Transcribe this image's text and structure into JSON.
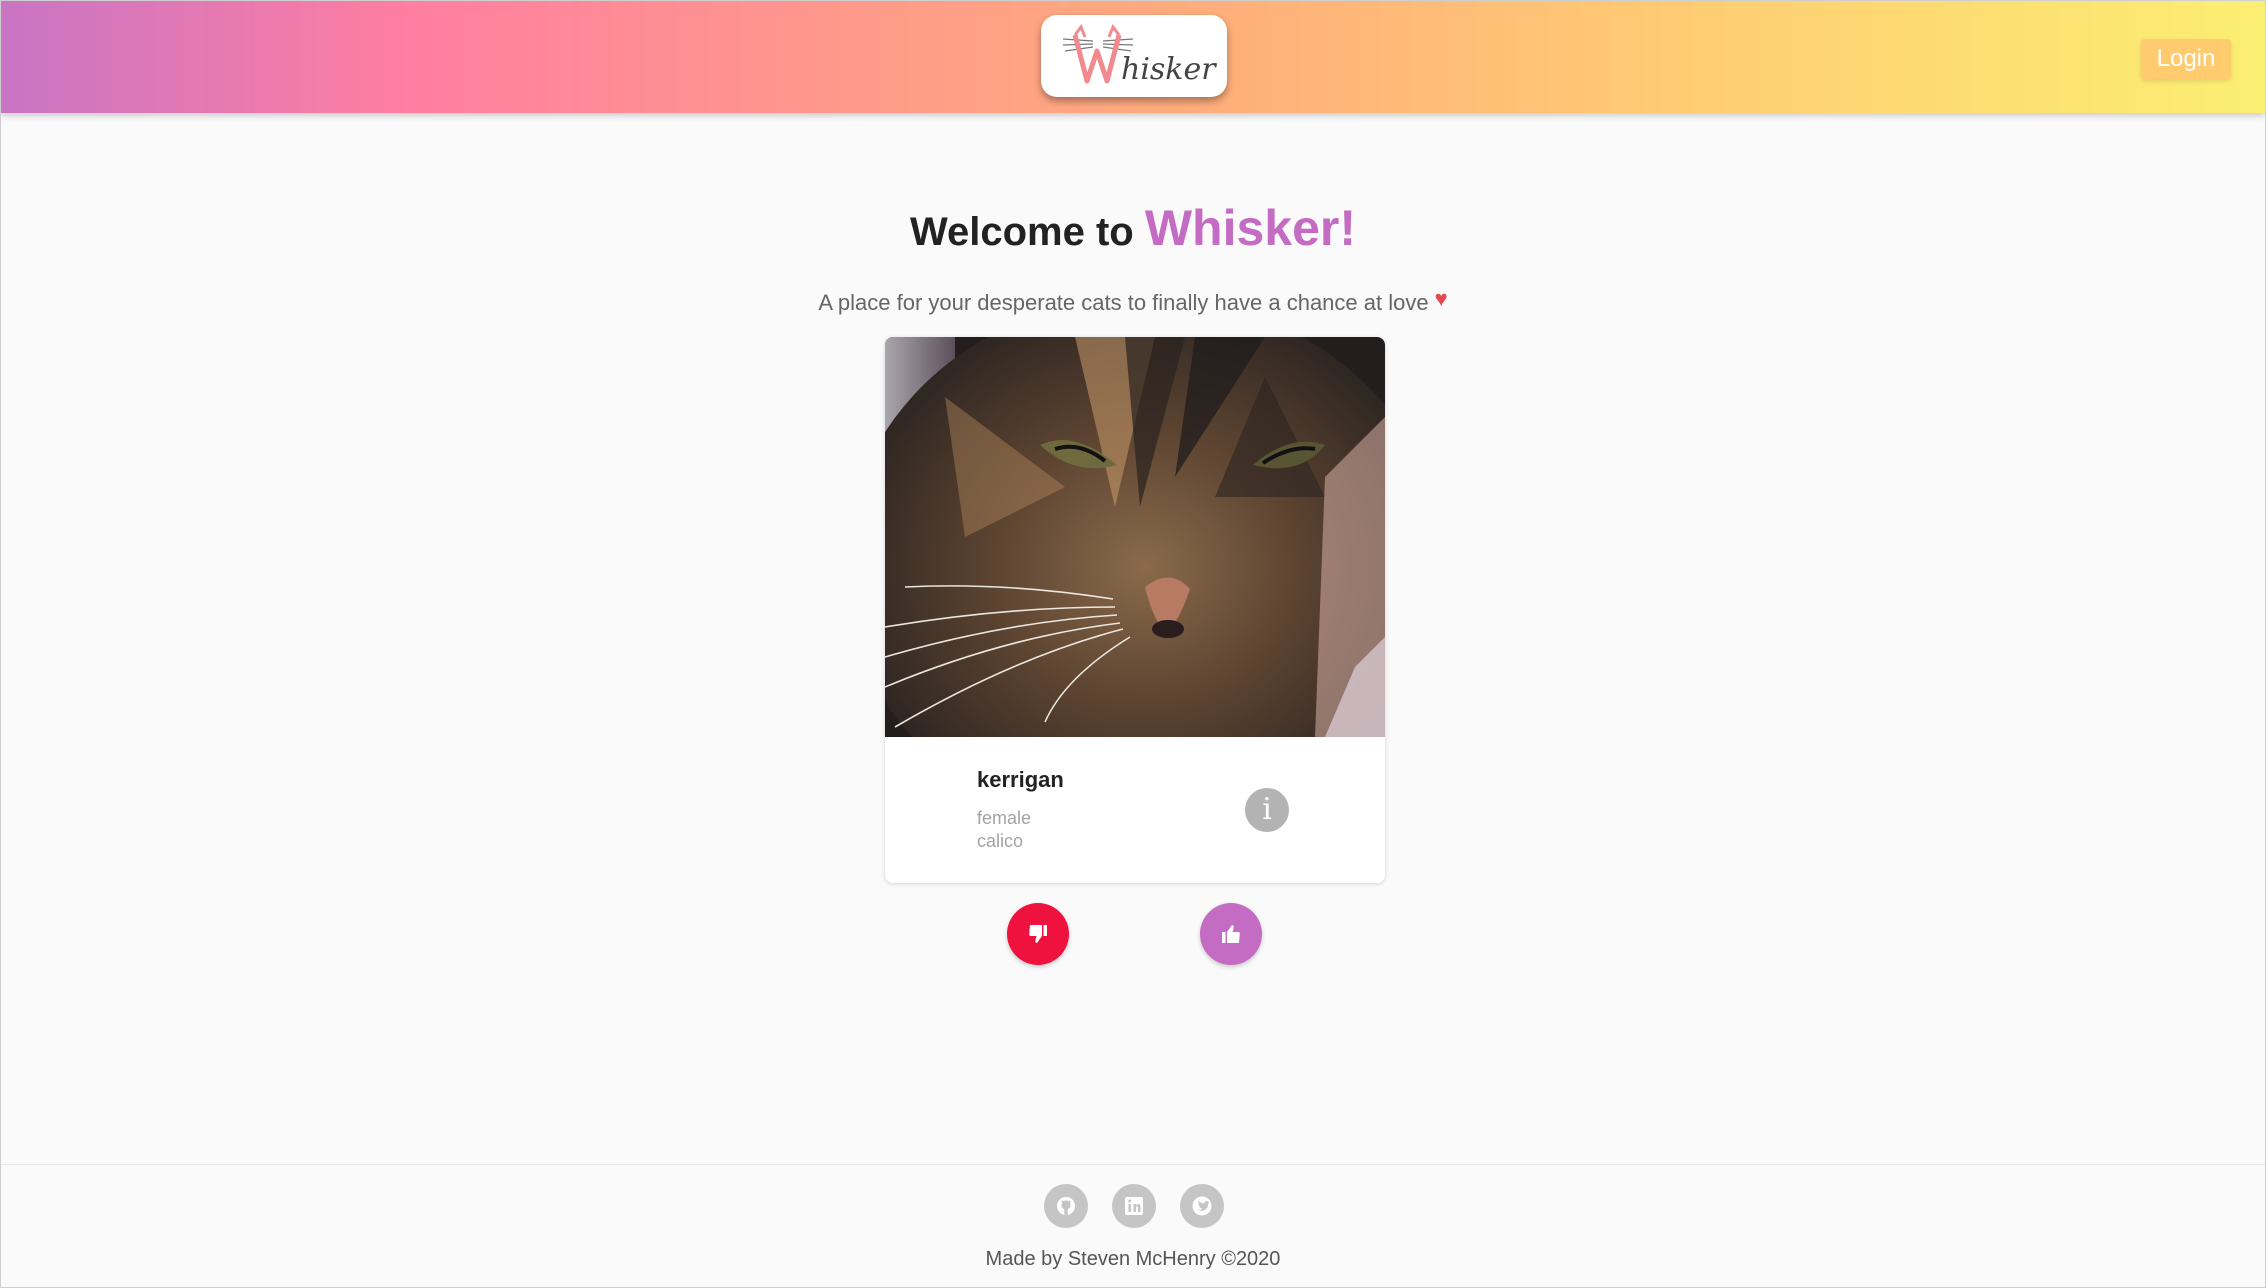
{
  "header": {
    "logo_text": "Whisker",
    "login_label": "Login",
    "gradient_start": "#c974c4",
    "gradient_end": "#fbef72"
  },
  "main": {
    "welcome_prefix": "Welcome to",
    "welcome_brand": "Whisker!",
    "tagline": "A place for your desperate cats to finally have a chance at love",
    "brand_color": "#c46bc3"
  },
  "card": {
    "name": "kerrigan",
    "sex": "female",
    "breed": "calico",
    "info_icon": "info-icon"
  },
  "actions": {
    "dislike_icon": "thumbs-down-icon",
    "dislike_color": "#f0123e",
    "like_icon": "thumbs-up-icon",
    "like_color": "#c46bc3"
  },
  "footer": {
    "social": [
      "github-icon",
      "linkedin-icon",
      "twitter-icon"
    ],
    "credit": "Made by Steven McHenry ©2020"
  }
}
